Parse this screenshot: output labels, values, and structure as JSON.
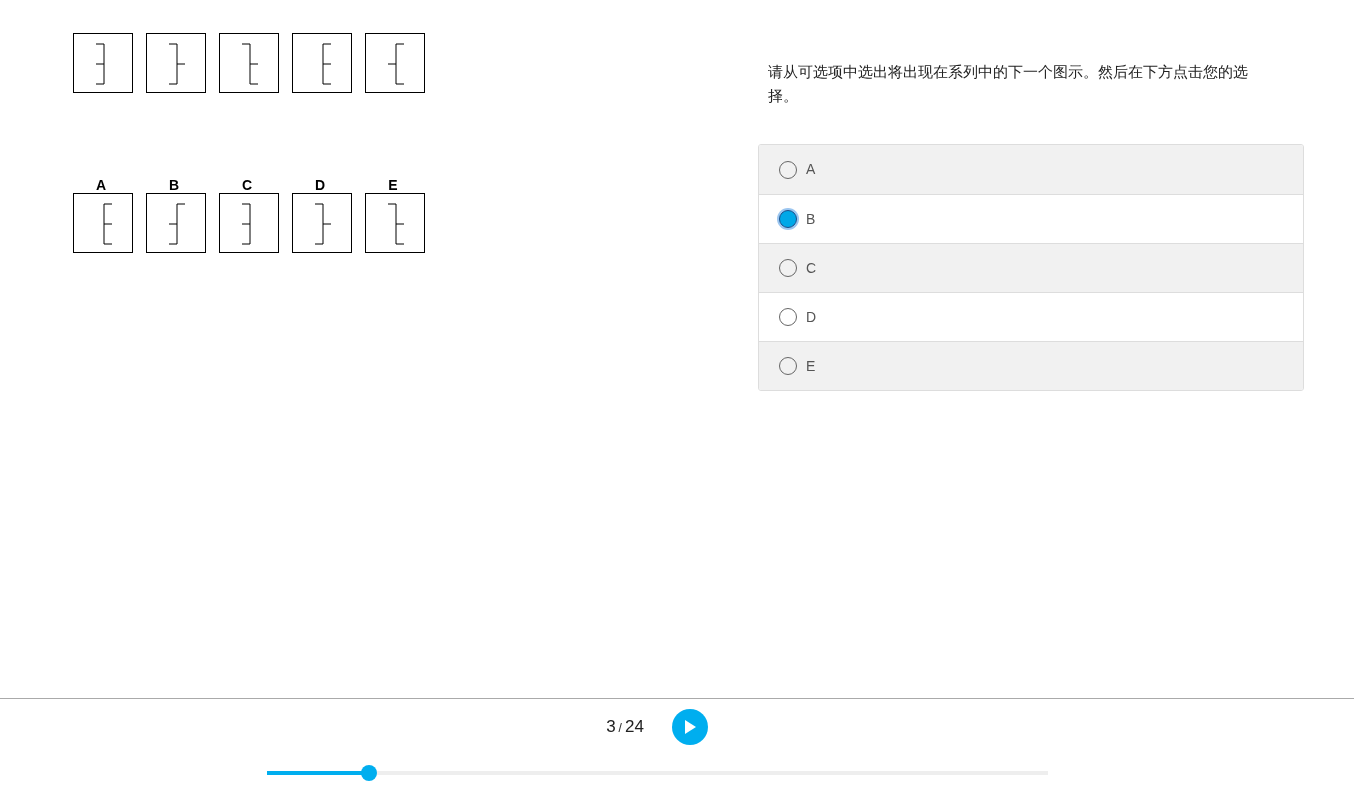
{
  "answer_labels": [
    "A",
    "B",
    "C",
    "D",
    "E"
  ],
  "question": {
    "text": "请从可选项中选出将出现在系列中的下一个图示。然后在下方点击您的选择。"
  },
  "options": [
    {
      "label": "A",
      "selected": false
    },
    {
      "label": "B",
      "selected": true
    },
    {
      "label": "C",
      "selected": false
    },
    {
      "label": "D",
      "selected": false
    },
    {
      "label": "E",
      "selected": false
    }
  ],
  "pager": {
    "current": "3",
    "separator": "/",
    "total": "24"
  },
  "progress": {
    "level": 0.13
  }
}
